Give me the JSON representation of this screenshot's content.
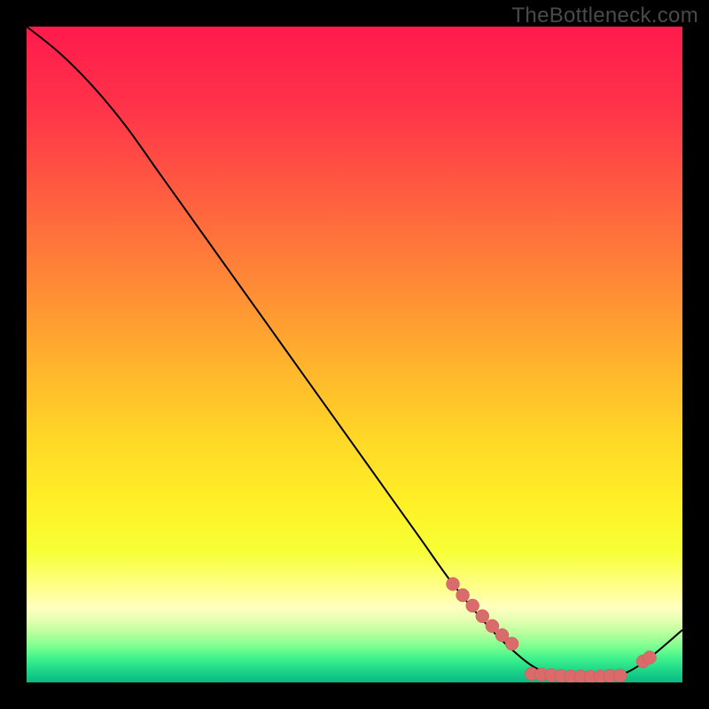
{
  "watermark": "TheBottleneck.com",
  "colors": {
    "curve_stroke": "#000000",
    "dot_fill": "#d96b6b",
    "dot_stroke": "#c95a5a"
  },
  "chart_data": {
    "type": "line",
    "title": "",
    "xlabel": "",
    "ylabel": "",
    "xlim": [
      0,
      100
    ],
    "ylim": [
      0,
      100
    ],
    "grid": false,
    "series": [
      {
        "name": "bottleneck-curve",
        "x": [
          0,
          5,
          10,
          15,
          20,
          25,
          30,
          35,
          40,
          45,
          50,
          55,
          60,
          65,
          70,
          74,
          78,
          82,
          86,
          90,
          94,
          100
        ],
        "y": [
          100,
          96,
          91,
          85,
          78,
          71,
          64,
          57,
          50,
          43,
          36,
          29,
          22,
          15,
          9,
          5,
          2,
          1,
          0.5,
          1,
          3,
          8
        ]
      }
    ],
    "scatter": {
      "name": "highlight-dots",
      "points": [
        {
          "x": 65,
          "y": 15
        },
        {
          "x": 66.5,
          "y": 13.3
        },
        {
          "x": 68,
          "y": 11.7
        },
        {
          "x": 69.5,
          "y": 10.1
        },
        {
          "x": 71,
          "y": 8.6
        },
        {
          "x": 72.5,
          "y": 7.2
        },
        {
          "x": 74,
          "y": 5.9
        },
        {
          "x": 77,
          "y": 1.3
        },
        {
          "x": 78.5,
          "y": 1.2
        },
        {
          "x": 80,
          "y": 1.1
        },
        {
          "x": 81.5,
          "y": 1.0
        },
        {
          "x": 83,
          "y": 0.9
        },
        {
          "x": 84.5,
          "y": 0.9
        },
        {
          "x": 86,
          "y": 0.85
        },
        {
          "x": 87.5,
          "y": 0.9
        },
        {
          "x": 89,
          "y": 1.0
        },
        {
          "x": 90.5,
          "y": 1.05
        },
        {
          "x": 94,
          "y": 3.2
        },
        {
          "x": 95,
          "y": 3.8
        }
      ]
    },
    "gradient_stops": [
      {
        "offset": 0.0,
        "color": "#ff1a4d"
      },
      {
        "offset": 0.13,
        "color": "#ff3549"
      },
      {
        "offset": 0.27,
        "color": "#ff623f"
      },
      {
        "offset": 0.4,
        "color": "#ff8c35"
      },
      {
        "offset": 0.52,
        "color": "#ffb52c"
      },
      {
        "offset": 0.63,
        "color": "#ffd827"
      },
      {
        "offset": 0.73,
        "color": "#fff127"
      },
      {
        "offset": 0.8,
        "color": "#f7ff35"
      },
      {
        "offset": 0.86,
        "color": "#ffff92"
      },
      {
        "offset": 0.885,
        "color": "#ffffc0"
      },
      {
        "offset": 0.905,
        "color": "#e4ffb0"
      },
      {
        "offset": 0.925,
        "color": "#b8ff9e"
      },
      {
        "offset": 0.945,
        "color": "#7dff90"
      },
      {
        "offset": 0.965,
        "color": "#3cf08c"
      },
      {
        "offset": 0.985,
        "color": "#18d188"
      },
      {
        "offset": 1.0,
        "color": "#0bb884"
      }
    ]
  }
}
